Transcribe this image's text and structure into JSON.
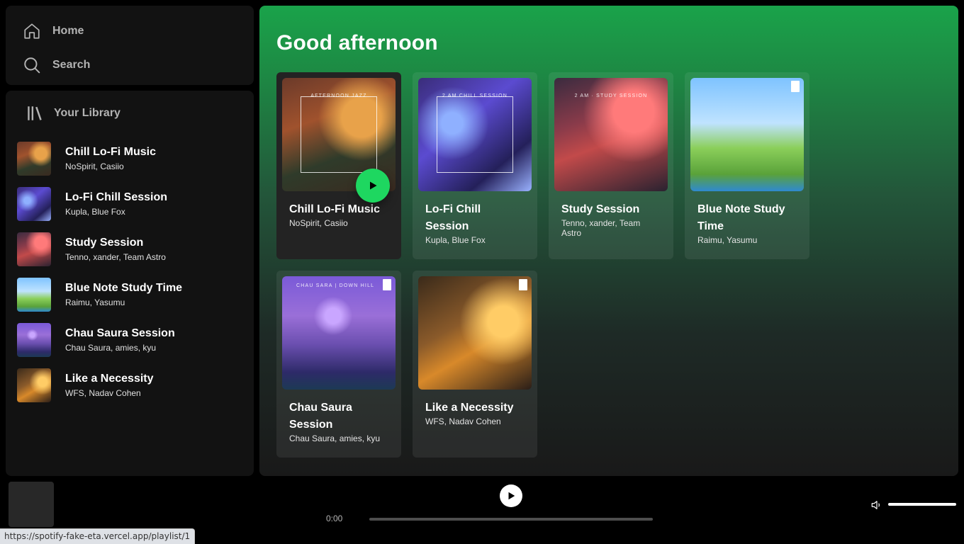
{
  "nav": {
    "home_label": "Home",
    "search_label": "Search"
  },
  "library": {
    "title": "Your Library",
    "items": [
      {
        "title": "Chill Lo-Fi Music",
        "artists": "NoSpirit, Casiio"
      },
      {
        "title": "Lo-Fi Chill Session",
        "artists": "Kupla, Blue Fox"
      },
      {
        "title": "Study Session",
        "artists": "Tenno, xander, Team Astro"
      },
      {
        "title": "Blue Note Study Time",
        "artists": "Raimu, Yasumu"
      },
      {
        "title": "Chau Saura Session",
        "artists": "Chau Saura, amies, kyu"
      },
      {
        "title": "Like a Necessity",
        "artists": "WFS, Nadav Cohen"
      }
    ]
  },
  "main": {
    "greeting": "Good afternoon",
    "cards": [
      {
        "title": "Chill Lo-Fi Music",
        "artists": "NoSpirit, Casiio",
        "art_text": "AFTERNOON JAZZ"
      },
      {
        "title": "Lo-Fi Chill Session",
        "artists": "Kupla, Blue Fox",
        "art_text": "2 AM CHILL SESSION"
      },
      {
        "title": "Study Session",
        "artists": "Tenno, xander, Team Astro",
        "art_text": "2 AM · STUDY SESSION"
      },
      {
        "title": "Blue Note Study Time",
        "artists": "Raimu, Yasumu",
        "art_text": ""
      },
      {
        "title": "Chau Saura Session",
        "artists": "Chau Saura, amies, kyu",
        "art_text": "CHAU SARA | DOWN HILL"
      },
      {
        "title": "Like a Necessity",
        "artists": "WFS, Nadav Cohen",
        "art_text": ""
      }
    ]
  },
  "player": {
    "current_time": "0:00",
    "progress": 0,
    "volume": 1
  },
  "status_bar": {
    "url": "https://spotify-fake-eta.vercel.app/playlist/1"
  },
  "colors": {
    "accent": "#1ed760",
    "background": "#121212"
  }
}
